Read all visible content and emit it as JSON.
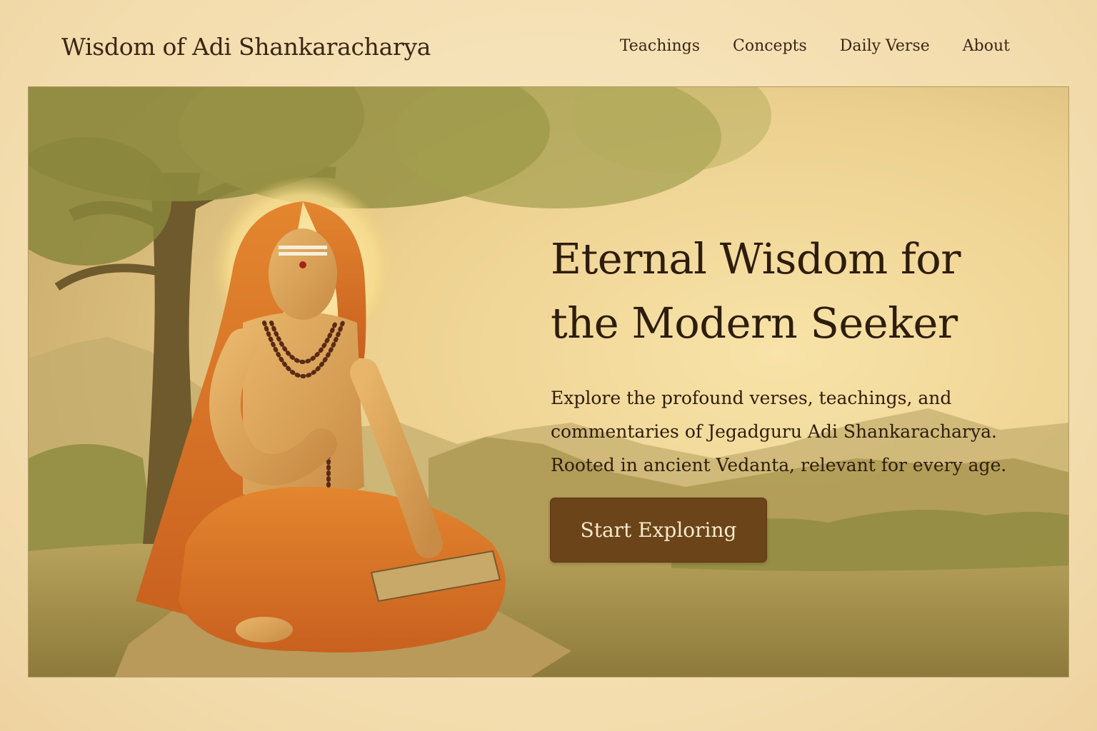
{
  "header": {
    "site_title": "Wisdom of Adi Shankaracharya",
    "nav": [
      {
        "label": "Teachings"
      },
      {
        "label": "Concepts"
      },
      {
        "label": "Daily Verse"
      },
      {
        "label": "About"
      }
    ]
  },
  "hero": {
    "title_line1": "Eternal Wisdom for",
    "title_line2": "the Modern Seeker",
    "subtitle_line1": "Explore the profound verses, teachings, and",
    "subtitle_line2": "commentaries of Jegadguru Adi Shankaracharya.",
    "subtitle_line3": "Rooted in ancient Vedanta, relevant for every age.",
    "cta_label": "Start Exploring",
    "image_icon": "sage-meditating-under-tree-illustration"
  },
  "colors": {
    "background": "#f5e2b8",
    "cta_background": "#6b4419",
    "cta_text": "#f7e9cb",
    "text": "#2e1d0c",
    "robe": "#d9722a"
  }
}
